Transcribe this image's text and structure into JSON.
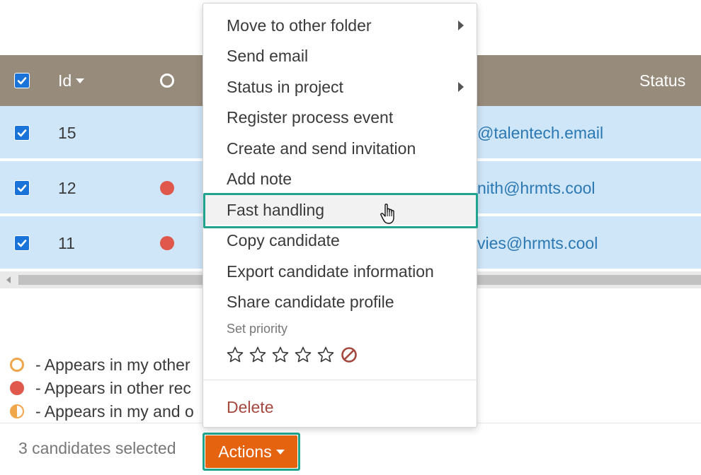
{
  "table": {
    "header": {
      "id_label": "Id",
      "status_label": "Status"
    },
    "rows": [
      {
        "id": "15",
        "email": "@talentech.email",
        "mark": "none"
      },
      {
        "id": "12",
        "email": "nith@hrmts.cool",
        "mark": "red"
      },
      {
        "id": "11",
        "email": "vies@hrmts.cool",
        "mark": "red"
      }
    ]
  },
  "legend": [
    {
      "symbol": "orange-ring",
      "text": "- Appears in my other"
    },
    {
      "symbol": "red-dot",
      "text": "- Appears in other rec"
    },
    {
      "symbol": "half-orange",
      "text": "- Appears in my and o"
    }
  ],
  "footer": {
    "selected_text": "3 candidates selected",
    "actions_label": "Actions"
  },
  "menu": {
    "items": [
      {
        "label": "Move to other folder",
        "submenu": true
      },
      {
        "label": "Send email",
        "submenu": false
      },
      {
        "label": "Status in project",
        "submenu": true
      },
      {
        "label": "Register process event",
        "submenu": false
      },
      {
        "label": "Create and send invitation",
        "submenu": false
      },
      {
        "label": "Add note",
        "submenu": false
      },
      {
        "label": "Fast handling",
        "submenu": false,
        "hovered": true
      },
      {
        "label": "Copy candidate",
        "submenu": false
      },
      {
        "label": "Export candidate information",
        "submenu": false
      },
      {
        "label": "Share candidate profile",
        "submenu": false
      }
    ],
    "priority_label": "Set priority",
    "priority_stars": 5,
    "delete_label": "Delete"
  },
  "colors": {
    "header_bg": "#978b7b",
    "row_bg": "#cfe6f8",
    "link": "#2b78b3",
    "checkbox": "#1a73d9",
    "accent_orange": "#e5630e",
    "highlight_teal": "#1fa58f",
    "red_dot": "#e0574c",
    "delete_text": "#a5483f"
  },
  "icons": [
    "checkbox-checked-icon",
    "sort-caret-icon",
    "status-ring-icon",
    "red-dot-icon",
    "submenu-arrow-icon",
    "star-icon",
    "no-priority-icon",
    "hand-cursor-icon",
    "caret-down-icon"
  ]
}
